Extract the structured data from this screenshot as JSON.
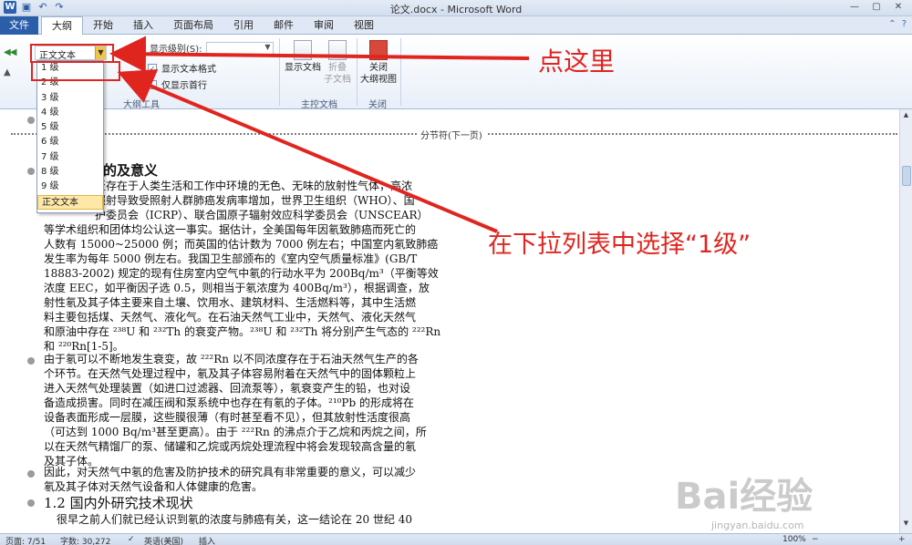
{
  "window": {
    "title": "论文.docx - Microsoft Word",
    "app_icon": "W"
  },
  "ribbon_tabs": {
    "file": "文件",
    "tabs": [
      "大纲",
      "开始",
      "插入",
      "页面布局",
      "引用",
      "邮件",
      "审阅",
      "视图"
    ]
  },
  "outline_tools": {
    "style_combo_value": "正文文本",
    "show_level_label": "显示级别(S):",
    "show_text_format": "显示文本格式",
    "show_first_line_only": "仅显示首行",
    "group_label": "大纲工具"
  },
  "master_doc": {
    "show_doc": "显示文档",
    "collapse_line1": "折叠",
    "collapse_line2": "子文档",
    "group_label": "主控文档"
  },
  "close_group": {
    "close_line1": "关闭",
    "close_line2": "大纲视图",
    "group_label": "关闭"
  },
  "dropdown": {
    "items": [
      "1 级",
      "2 级",
      "3 级",
      "4 级",
      "5 级",
      "6 级",
      "7 级",
      "8 级",
      "9 级",
      "正文文本"
    ]
  },
  "document": {
    "section_break": "分节符(下一页)",
    "heading1": "目的及意义",
    "para1": [
      "泛存在于人类生活和工作中环境的无色、无味的放射性气体，高浓",
      "照射导致受照射人群肺癌发病率增加，世界卫生组织（WHO）、国",
      "护委员会（ICRP）、联合国原子辐射效应科学委员会（UNSCEAR）",
      "等学术组织和团体均公认这一事实。据估计，全美国每年因氡致肺癌而死亡的",
      "人数有 15000~25000 例；而英国的估计数为 7000 例左右；中国室内氡致肺癌",
      "发生率为每年 5000 例左右。我国卫生部颁布的《室内空气质量标准》(GB/T",
      "18883-2002) 规定的现有住房室内空气中氡的行动水平为 200Bq/m³（平衡等效",
      "浓度 EEC，如平衡因子选 0.5，则相当于氡浓度为 400Bq/m³），根据调查，放",
      "射性氡及其子体主要来自土壤、饮用水、建筑材料、生活燃料等，其中生活燃",
      "料主要包括煤、天然气、液化气。在石油天然气工业中，天然气、液化天然气",
      "和原油中存在 ²³⁸U 和 ²³²Th 的衰变产物。²³⁸U 和 ²³²Th 将分别产生气态的 ²²²Rn",
      "和 ²²⁰Rn[1-5]。"
    ],
    "para2": [
      "由于氡可以不断地发生衰变，故 ²²²Rn 以不同浓度存在于石油天然气生产的各",
      "个环节。在天然气处理过程中，氡及其子体容易附着在天然气中的固体颗粒上",
      "进入天然气处理装置（如进口过滤器、回流泵等），氡衰变产生的铅，也对设",
      "备造成损害。同时在减压阀和泵系统中也存在有氡的子体。²¹⁰Pb 的形成将在",
      "设备表面形成一层膜，这些膜很薄（有时甚至看不见），但其放射性活度很高",
      "（可达到 1000 Bq/m³甚至更高）。由于 ²²²Rn 的沸点介于乙烷和丙烷之间，所",
      "以在天然气精馏厂的泵、储罐和乙烷或丙烷处理流程中将会发现较高含量的氡",
      "及其子体。"
    ],
    "para3": [
      "因此，对天然气中氡的危害及防护技术的研究具有非常重要的意义，可以减少",
      "氡及其子体对天然气设备和人体健康的危害。"
    ],
    "heading2": "1.2 国内外研究技术现状",
    "para4_partial": "很早之前人们就已经认识到氡的浓度与肺癌有关，这一结论在 20 世纪 40"
  },
  "statusbar": {
    "page": "页面: 7/51",
    "words": "字数: 30,272",
    "language": "英语(美国)",
    "mode": "插入",
    "zoom": "100%"
  },
  "annotations": {
    "click_here": "点这里",
    "select_level1": "在下拉列表中选择“1级”",
    "color": "#e0251f"
  },
  "watermark": {
    "logo": "Bai经验",
    "url": "jingyan.baidu.com"
  }
}
